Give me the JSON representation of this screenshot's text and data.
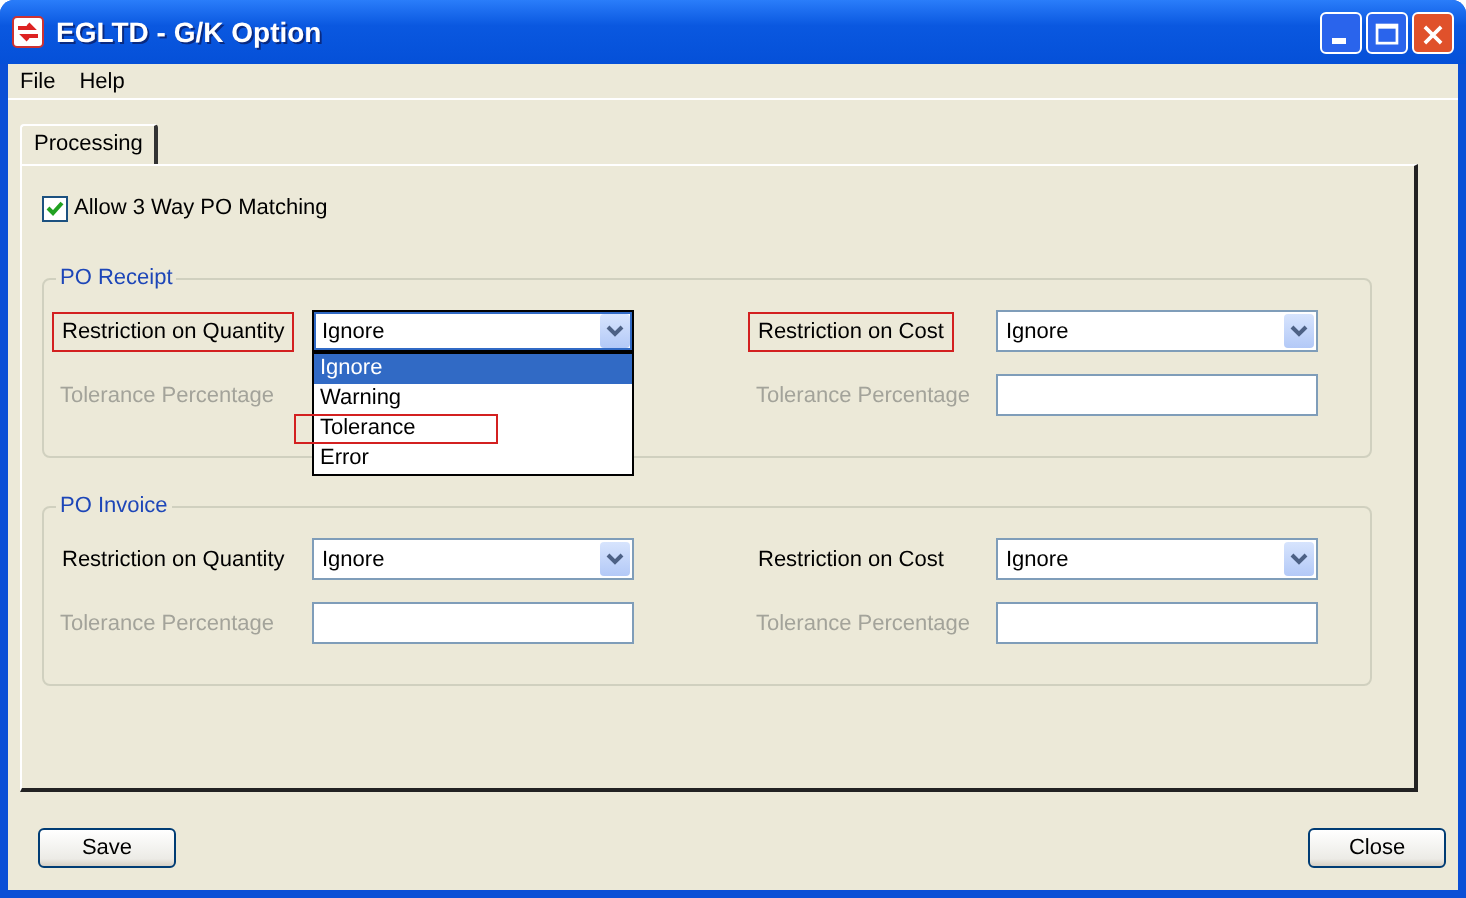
{
  "window": {
    "title": "EGLTD - G/K Option"
  },
  "menu": [
    {
      "label": "File"
    },
    {
      "label": "Help"
    }
  ],
  "tabs": [
    {
      "label": "Processing",
      "selected": true
    }
  ],
  "matching": {
    "label": "Allow 3 Way PO Matching",
    "checked": true
  },
  "groups": [
    {
      "title": "PO Receipt",
      "fields": [
        {
          "label": "Restriction on Quantity",
          "highlighted": true,
          "value": "Ignore",
          "expanded": true,
          "options": [
            {
              "label": "Ignore",
              "selected": true,
              "highlighted": false
            },
            {
              "label": "Warning",
              "selected": false,
              "highlighted": false
            },
            {
              "label": "Tolerance",
              "selected": false,
              "highlighted": true
            },
            {
              "label": "Error",
              "selected": false,
              "highlighted": false
            }
          ],
          "tolerance_label": "Tolerance Percentage",
          "tolerance_disabled": true
        },
        {
          "label": "Restriction on Cost",
          "highlighted": true,
          "value": "Ignore",
          "expanded": false,
          "tolerance_label": "Tolerance Percentage",
          "tolerance_disabled": true
        }
      ]
    },
    {
      "title": "PO Invoice",
      "fields": [
        {
          "label": "Restriction on Quantity",
          "highlighted": false,
          "value": "Ignore",
          "expanded": false,
          "tolerance_label": "Tolerance Percentage",
          "tolerance_disabled": true
        },
        {
          "label": "Restriction on Cost",
          "highlighted": false,
          "value": "Ignore",
          "expanded": false,
          "tolerance_label": "Tolerance Percentage",
          "tolerance_disabled": true
        }
      ]
    }
  ],
  "buttons": [
    {
      "label": "Save"
    },
    {
      "label": "Close"
    }
  ]
}
